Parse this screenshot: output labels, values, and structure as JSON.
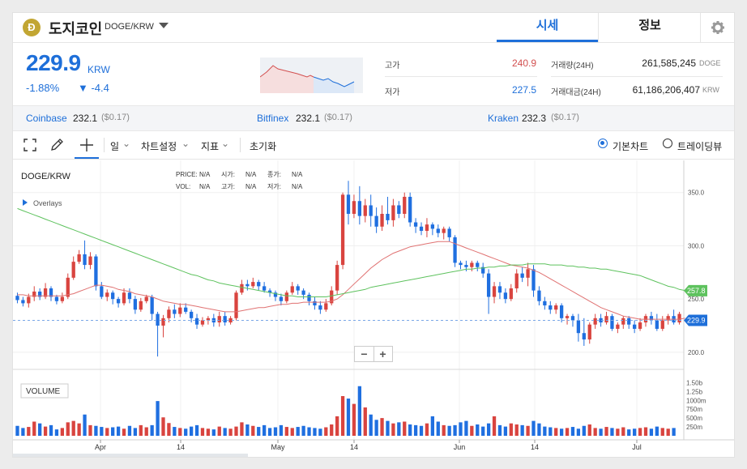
{
  "header": {
    "coin_icon": "Đ",
    "coin_name": "도지코인",
    "coin_symbol": "DOGE/KRW",
    "tab_market": "시세",
    "tab_info": "정보",
    "settings_icon": "gear-icon"
  },
  "price": {
    "value": "229.9",
    "unit": "KRW",
    "change_pct": "-1.88%",
    "change_abs": "▼ -4.4"
  },
  "stats": {
    "high_label": "고가",
    "high_value": "240.9",
    "low_label": "저가",
    "low_value": "227.5",
    "vol_label": "거래량(24H)",
    "vol_value": "261,585,245",
    "vol_unit": "DOGE",
    "amt_label": "거래대금(24H)",
    "amt_value": "61,186,206,407",
    "amt_unit": "KRW"
  },
  "exchanges": [
    {
      "name": "Coinbase",
      "price": "232.1",
      "usd": "($0.17)"
    },
    {
      "name": "Bitfinex",
      "price": "232.1",
      "usd": "($0.17)"
    },
    {
      "name": "Kraken",
      "price": "232.3",
      "usd": "($0.17)"
    }
  ],
  "toolbar": {
    "period": "일",
    "chart_settings": "차트설정",
    "indicators": "지표",
    "reset": "초기화",
    "basic_chart": "기본차트",
    "tradingview": "트레이딩뷰"
  },
  "chart_labels": {
    "symbol": "DOGE/KRW",
    "price_lbl": "PRICE:",
    "price_val": "N/A",
    "open_lbl": "시가:",
    "open_val": "N/A",
    "close_lbl": "종가:",
    "close_val": "N/A",
    "vol_lbl": "VOL:",
    "vol_val": "N/A",
    "high_lbl": "고가:",
    "high_val": "N/A",
    "low_lbl": "저가:",
    "low_val": "N/A",
    "overlays": "Overlays",
    "volume": "VOLUME",
    "ma_tag": "257.8",
    "price_tag": "229.9"
  },
  "chart_data": {
    "type": "candlestick",
    "y_ticks": [
      "350.0",
      "300.0",
      "250.0",
      "200.0"
    ],
    "y_range": [
      190,
      365
    ],
    "vol_ticks": [
      "1.50b",
      "1.25b",
      "1000m",
      "750m",
      "500m",
      "250m"
    ],
    "vol_max": 1.6,
    "x_ticks": [
      "Apr",
      "14",
      "May",
      "14",
      "Jun",
      "14",
      "Jul"
    ],
    "candles": [
      [
        253,
        249,
        256,
        246
      ],
      [
        249,
        246,
        252,
        243
      ],
      [
        246,
        252,
        255,
        242
      ],
      [
        252,
        257,
        262,
        248
      ],
      [
        257,
        252,
        260,
        249
      ],
      [
        252,
        260,
        265,
        250
      ],
      [
        260,
        252,
        262,
        248
      ],
      [
        252,
        248,
        254,
        245
      ],
      [
        248,
        252,
        256,
        246
      ],
      [
        252,
        270,
        274,
        250
      ],
      [
        270,
        285,
        290,
        268
      ],
      [
        285,
        292,
        296,
        283
      ],
      [
        292,
        282,
        305,
        278
      ],
      [
        282,
        290,
        294,
        278
      ],
      [
        290,
        262,
        292,
        258
      ],
      [
        262,
        252,
        266,
        250
      ],
      [
        252,
        256,
        259,
        248
      ],
      [
        256,
        250,
        258,
        245
      ],
      [
        250,
        246,
        252,
        242
      ],
      [
        246,
        256,
        260,
        244
      ],
      [
        256,
        250,
        260,
        246
      ],
      [
        250,
        240,
        253,
        236
      ],
      [
        240,
        248,
        251,
        238
      ],
      [
        248,
        252,
        254,
        246
      ],
      [
        252,
        236,
        254,
        230
      ],
      [
        236,
        225,
        238,
        196
      ],
      [
        225,
        232,
        235,
        214
      ],
      [
        232,
        240,
        243,
        228
      ],
      [
        240,
        236,
        245,
        232
      ],
      [
        236,
        242,
        246,
        233
      ],
      [
        242,
        238,
        246,
        236
      ],
      [
        238,
        232,
        240,
        228
      ],
      [
        232,
        226,
        236,
        222
      ],
      [
        226,
        230,
        233,
        224
      ],
      [
        230,
        232,
        234,
        226
      ],
      [
        232,
        228,
        236,
        224
      ],
      [
        228,
        234,
        238,
        224
      ],
      [
        234,
        228,
        238,
        225
      ],
      [
        228,
        232,
        234,
        226
      ],
      [
        232,
        256,
        258,
        230
      ],
      [
        256,
        264,
        268,
        254
      ],
      [
        264,
        262,
        268,
        258
      ],
      [
        262,
        266,
        270,
        260
      ],
      [
        266,
        262,
        268,
        258
      ],
      [
        262,
        258,
        266,
        256
      ],
      [
        258,
        256,
        260,
        252
      ],
      [
        256,
        252,
        258,
        248
      ],
      [
        252,
        248,
        255,
        244
      ],
      [
        248,
        256,
        258,
        246
      ],
      [
        256,
        262,
        266,
        254
      ],
      [
        262,
        258,
        264,
        254
      ],
      [
        258,
        254,
        260,
        250
      ],
      [
        254,
        248,
        256,
        244
      ],
      [
        248,
        244,
        252,
        240
      ],
      [
        244,
        240,
        248,
        236
      ],
      [
        240,
        246,
        250,
        238
      ],
      [
        246,
        258,
        262,
        244
      ],
      [
        258,
        282,
        286,
        254
      ],
      [
        282,
        348,
        350,
        278
      ],
      [
        348,
        330,
        361,
        320
      ],
      [
        330,
        342,
        348,
        326
      ],
      [
        342,
        328,
        356,
        320
      ],
      [
        328,
        338,
        344,
        322
      ],
      [
        338,
        328,
        348,
        318
      ],
      [
        328,
        318,
        336,
        312
      ],
      [
        318,
        330,
        338,
        314
      ],
      [
        330,
        324,
        346,
        320
      ],
      [
        324,
        338,
        344,
        318
      ],
      [
        338,
        330,
        342,
        326
      ],
      [
        330,
        346,
        350,
        326
      ],
      [
        346,
        322,
        350,
        318
      ],
      [
        322,
        318,
        326,
        312
      ],
      [
        318,
        314,
        322,
        310
      ],
      [
        314,
        320,
        326,
        308
      ],
      [
        320,
        316,
        322,
        310
      ],
      [
        316,
        312,
        320,
        308
      ],
      [
        312,
        316,
        318,
        306
      ],
      [
        316,
        308,
        318,
        304
      ],
      [
        308,
        284,
        310,
        280
      ],
      [
        284,
        282,
        286,
        278
      ],
      [
        282,
        280,
        286,
        276
      ],
      [
        280,
        284,
        286,
        276
      ],
      [
        284,
        280,
        286,
        276
      ],
      [
        280,
        274,
        284,
        270
      ],
      [
        274,
        252,
        278,
        236
      ],
      [
        252,
        262,
        266,
        246
      ],
      [
        262,
        256,
        266,
        250
      ],
      [
        256,
        250,
        260,
        246
      ],
      [
        250,
        260,
        264,
        248
      ],
      [
        260,
        274,
        278,
        256
      ],
      [
        274,
        270,
        280,
        266
      ],
      [
        270,
        278,
        284,
        262
      ],
      [
        278,
        258,
        282,
        252
      ],
      [
        258,
        248,
        262,
        244
      ],
      [
        248,
        244,
        252,
        240
      ],
      [
        244,
        240,
        248,
        236
      ],
      [
        240,
        244,
        246,
        236
      ],
      [
        244,
        232,
        246,
        228
      ],
      [
        232,
        234,
        236,
        226
      ],
      [
        234,
        230,
        236,
        224
      ],
      [
        230,
        218,
        236,
        210
      ],
      [
        218,
        212,
        232,
        206
      ],
      [
        212,
        226,
        228,
        208
      ],
      [
        226,
        232,
        236,
        222
      ],
      [
        232,
        228,
        236,
        224
      ],
      [
        228,
        234,
        238,
        226
      ],
      [
        234,
        222,
        236,
        220
      ],
      [
        222,
        226,
        228,
        218
      ],
      [
        226,
        232,
        234,
        222
      ],
      [
        232,
        226,
        234,
        222
      ],
      [
        226,
        222,
        230,
        218
      ],
      [
        222,
        228,
        232,
        220
      ],
      [
        228,
        234,
        236,
        224
      ],
      [
        234,
        230,
        238,
        226
      ],
      [
        230,
        222,
        236,
        220
      ],
      [
        222,
        230,
        234,
        220
      ],
      [
        230,
        234,
        236,
        226
      ],
      [
        234,
        228,
        240,
        226
      ],
      [
        228,
        236,
        238,
        226
      ]
    ],
    "volumes": [
      0.28,
      0.22,
      0.25,
      0.4,
      0.35,
      0.26,
      0.3,
      0.18,
      0.22,
      0.38,
      0.42,
      0.35,
      0.6,
      0.3,
      0.28,
      0.25,
      0.22,
      0.24,
      0.26,
      0.2,
      0.28,
      0.22,
      0.3,
      0.24,
      0.3,
      0.98,
      0.52,
      0.36,
      0.25,
      0.22,
      0.2,
      0.26,
      0.3,
      0.22,
      0.2,
      0.18,
      0.26,
      0.22,
      0.2,
      0.26,
      0.38,
      0.32,
      0.28,
      0.25,
      0.3,
      0.22,
      0.24,
      0.3,
      0.25,
      0.22,
      0.25,
      0.28,
      0.24,
      0.22,
      0.2,
      0.24,
      0.32,
      0.55,
      1.12,
      1.05,
      0.9,
      1.4,
      0.8,
      0.6,
      0.45,
      0.5,
      0.42,
      0.35,
      0.38,
      0.4,
      0.32,
      0.3,
      0.28,
      0.35,
      0.55,
      0.4,
      0.3,
      0.28,
      0.3,
      0.38,
      0.42,
      0.28,
      0.32,
      0.26,
      0.35,
      0.55,
      0.3,
      0.26,
      0.35,
      0.32,
      0.3,
      0.28,
      0.42,
      0.35,
      0.26,
      0.24,
      0.22,
      0.2,
      0.22,
      0.25,
      0.2,
      0.28,
      0.32,
      0.22,
      0.2,
      0.25,
      0.22,
      0.2,
      0.24,
      0.18,
      0.2,
      0.22,
      0.24,
      0.2,
      0.26,
      0.22,
      0.2,
      0.22
    ],
    "ma_red": [
      254,
      254,
      253,
      253,
      253,
      253,
      253,
      253,
      253,
      254,
      255,
      257,
      259,
      261,
      263,
      263,
      262,
      261,
      259,
      258,
      257,
      255,
      254,
      253,
      252,
      250,
      248,
      247,
      246,
      245,
      245,
      244,
      243,
      242,
      241,
      240,
      239,
      238,
      238,
      238,
      239,
      240,
      241,
      242,
      242,
      243,
      244,
      245,
      245,
      246,
      246,
      247,
      247,
      247,
      247,
      247,
      248,
      250,
      254,
      259,
      264,
      269,
      274,
      279,
      283,
      287,
      290,
      293,
      295,
      297,
      299,
      300,
      301,
      302,
      303,
      304,
      304,
      304,
      302,
      300,
      298,
      296,
      294,
      292,
      290,
      288,
      286,
      284,
      282,
      281,
      280,
      279,
      277,
      275,
      272,
      269,
      266,
      263,
      260,
      257,
      254,
      251,
      248,
      245,
      242,
      240,
      238,
      236,
      234,
      233,
      232,
      231,
      231,
      231,
      231,
      231,
      231,
      231,
      231,
      232
    ],
    "ma_green": [
      335,
      333,
      331,
      329,
      327,
      325,
      323,
      321,
      319,
      317,
      315,
      313,
      311,
      309,
      307,
      305,
      303,
      301,
      299,
      297,
      295,
      293,
      291,
      289,
      287,
      285,
      283,
      281,
      279,
      277,
      275,
      273,
      272,
      270,
      268,
      267,
      265,
      264,
      263,
      262,
      261,
      260,
      259,
      258,
      257,
      256,
      255,
      254,
      253,
      253,
      252,
      252,
      252,
      252,
      252,
      252,
      253,
      254,
      255,
      256,
      257,
      258,
      259,
      261,
      262,
      263,
      264,
      265,
      266,
      267,
      268,
      269,
      270,
      271,
      272,
      273,
      274,
      275,
      276,
      277,
      278,
      278,
      279,
      279,
      280,
      280,
      281,
      281,
      282,
      282,
      282,
      283,
      283,
      283,
      283,
      282,
      282,
      282,
      281,
      281,
      280,
      280,
      279,
      279,
      278,
      278,
      277,
      276,
      275,
      274,
      273,
      272,
      270,
      268,
      266,
      264,
      262,
      261,
      259,
      258
    ]
  }
}
